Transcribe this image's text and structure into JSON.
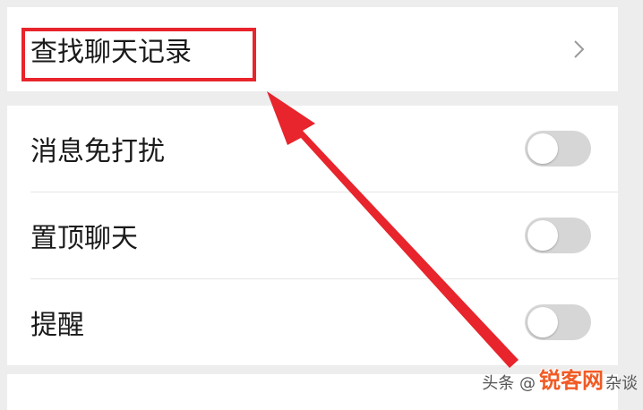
{
  "rows": {
    "search_history": {
      "label": "查找聊天记录"
    },
    "mute": {
      "label": "消息免打扰",
      "on": false
    },
    "pin": {
      "label": "置顶聊天",
      "on": false
    },
    "remind": {
      "label": "提醒",
      "on": false
    }
  },
  "colors": {
    "highlight": "#e8242c",
    "arrow": "#e8242c",
    "toggle_off": "#d6d6d6",
    "background": "#ededed",
    "watermark_brand": "#f15a24"
  },
  "watermark": {
    "prefix": "头条 @",
    "brand": "锐客网",
    "suffix": "杂谈"
  }
}
